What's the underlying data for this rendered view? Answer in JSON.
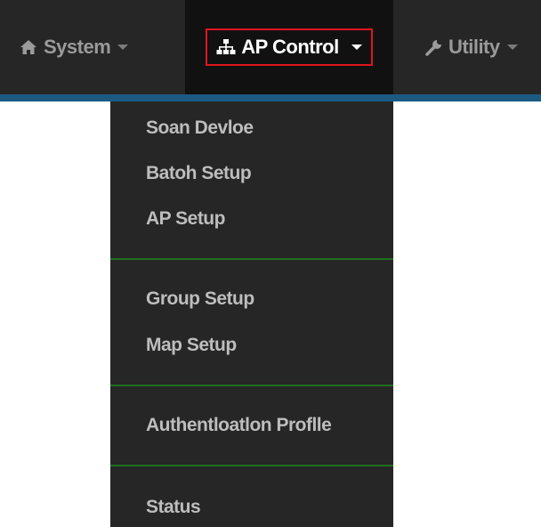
{
  "navbar": {
    "items": [
      {
        "label": "System",
        "icon": "home-icon"
      },
      {
        "label": "AP Control",
        "icon": "sitemap-icon"
      },
      {
        "label": "Utility",
        "icon": "wrench-icon"
      }
    ]
  },
  "dropdown": {
    "items": [
      {
        "label": "Soan Devloe"
      },
      {
        "label": "Batoh Setup"
      },
      {
        "label": "AP Setup"
      },
      {
        "label": "Group Setup"
      },
      {
        "label": "Map Setup"
      },
      {
        "label": "Authentloatlon Proflle"
      },
      {
        "label": "Status"
      }
    ]
  },
  "colors": {
    "navbar_bg": "#262626",
    "active_bg": "#111111",
    "highlight_border": "#e0141e",
    "accent_line": "#1c5a84",
    "divider": "#1f6e1f",
    "menu_text": "#bdbdbd"
  }
}
